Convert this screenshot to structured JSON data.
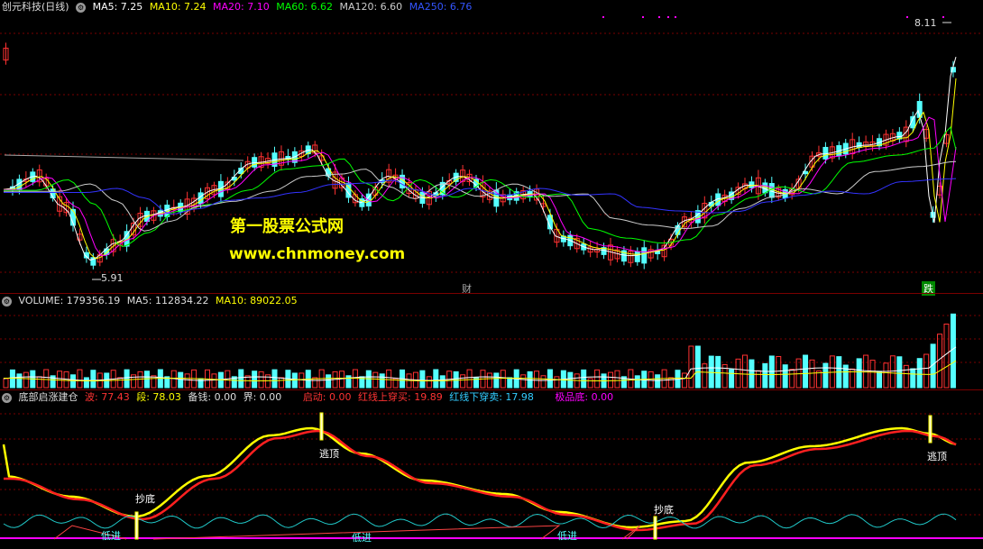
{
  "main": {
    "title": "创元科技(日线)",
    "ma": [
      {
        "label": "MA5: 7.25",
        "color": "#ffffff"
      },
      {
        "label": "MA10: 7.24",
        "color": "#ffff00"
      },
      {
        "label": "MA20: 7.10",
        "color": "#ff00ff"
      },
      {
        "label": "MA60: 6.62",
        "color": "#00ff00"
      },
      {
        "label": "MA120: 6.60",
        "color": "#cccccc"
      },
      {
        "label": "MA250: 6.76",
        "color": "#3333ff"
      }
    ],
    "high_label": "8.11",
    "low_label": "5.91",
    "marker_cai": "财",
    "marker_die": "跌",
    "watermark_cn": "第一股票公式网",
    "watermark_url": "www.chnmoney.com"
  },
  "volume": {
    "title": "VOLUME: 179356.19",
    "ma5": "MA5: 112834.22",
    "ma10": "MA10: 89022.05"
  },
  "indicator": {
    "title": "底部启涨建仓",
    "items": [
      {
        "label": "波: 77.43",
        "color": "#ff3333"
      },
      {
        "label": "段: 78.03",
        "color": "#ffff00"
      },
      {
        "label": "备钱: 0.00",
        "color": "#dddddd"
      },
      {
        "label": "界: 0.00",
        "color": "#dddddd"
      },
      {
        "label": "启动: 0.00",
        "color": "#ff3333"
      },
      {
        "label": "红线上穿买: 19.89",
        "color": "#ff3333"
      },
      {
        "label": "红线下穿卖: 17.98",
        "color": "#33ccff"
      },
      {
        "label": "极品底: 0.00",
        "color": "#ff00ff"
      }
    ],
    "signals": {
      "escape1": "逃顶",
      "escape2": "逃顶",
      "bottom1": "抄底",
      "bottom2": "抄底",
      "low_in1": "低进",
      "low_in2": "低进",
      "low_in3": "低进"
    }
  },
  "colors": {
    "up": "#ff3232",
    "down": "#54ffff",
    "separator": "#7a0000",
    "grid": "#7a0000",
    "purple": "#ff00ff"
  }
}
